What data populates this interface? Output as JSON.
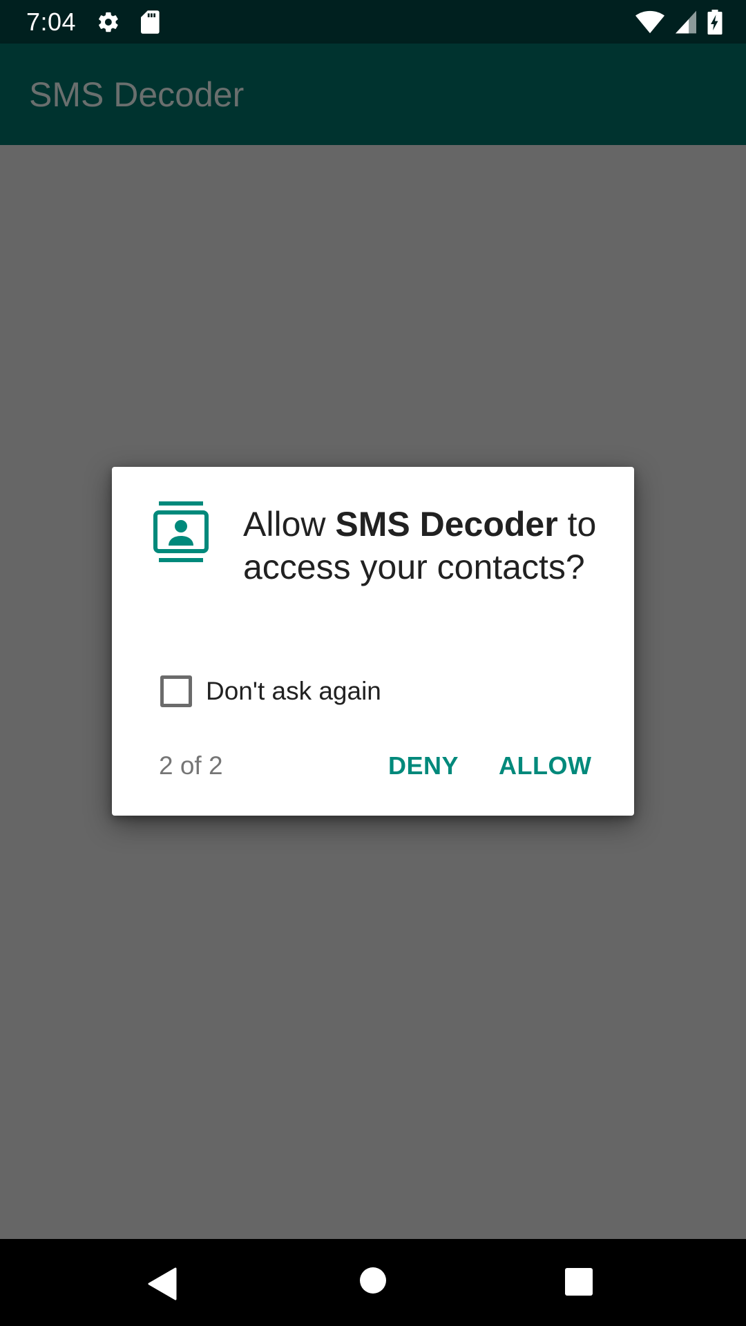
{
  "status_bar": {
    "time": "7:04",
    "left_icons": [
      "gear-icon",
      "sd-card-icon"
    ],
    "right_icons": [
      "wifi-icon",
      "cell-signal-icon",
      "battery-charging-icon"
    ]
  },
  "app_bar": {
    "title": "SMS Decoder"
  },
  "dialog": {
    "icon": "contacts-icon",
    "message_prefix": "Allow ",
    "app_name": "SMS Decoder",
    "message_suffix": " to access your contacts?",
    "checkbox_label": "Don't ask again",
    "checkbox_checked": false,
    "page_counter": "2 of 2",
    "deny_label": "DENY",
    "allow_label": "ALLOW"
  },
  "nav_bar": {
    "icons": [
      "back-icon",
      "home-icon",
      "recents-icon"
    ]
  },
  "colors": {
    "status_bar": "#00201f",
    "app_bar": "#00332f",
    "scrim": "#666666",
    "accent": "#00897b"
  }
}
